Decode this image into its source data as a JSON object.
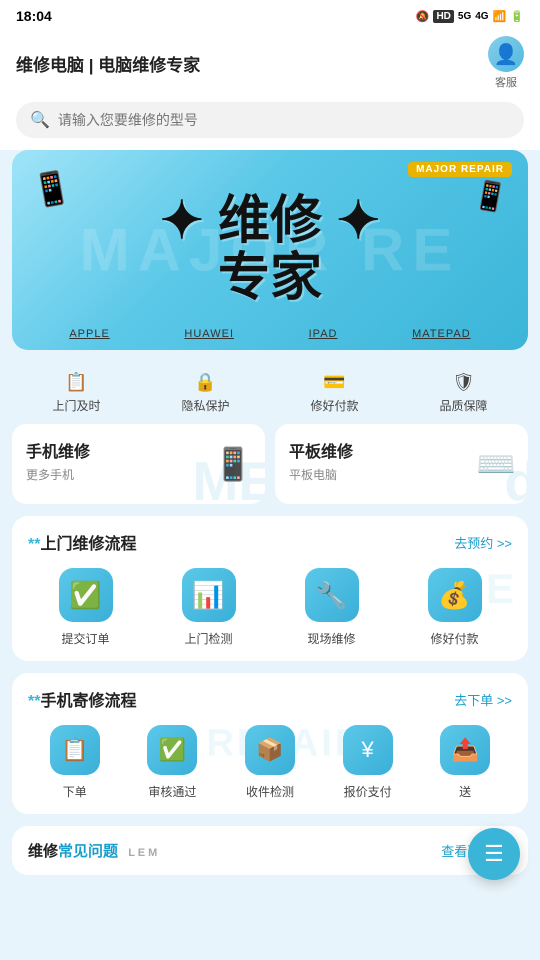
{
  "statusBar": {
    "time": "18:04",
    "icons": [
      "🔕",
      "HD",
      "5G",
      "4G",
      "WiFi",
      "Battery"
    ]
  },
  "header": {
    "title": "维修电脑 | 电脑维修专家",
    "customerService": "客服"
  },
  "search": {
    "placeholder": "请输入您要维修的型号"
  },
  "banner": {
    "badge": "MAJOR REPAIR",
    "mainText": "维修",
    "mainText2": "专家",
    "bgText": "MAJOR RE",
    "brands": [
      "APPLE",
      "HUAWEI",
      "IPAD",
      "MATEPAD"
    ]
  },
  "features": [
    {
      "icon": "📋",
      "label": "上门及时"
    },
    {
      "icon": "🔒",
      "label": "隐私保护"
    },
    {
      "icon": "💳",
      "label": "修好付款"
    },
    {
      "icon": "🛡",
      "label": "品质保障"
    }
  ],
  "serviceCards": [
    {
      "title": "手机维修",
      "subtitle": "更多手机",
      "icon": "📱",
      "bgText": "ME"
    },
    {
      "title": "平板维修",
      "subtitle": "平板电脑",
      "icon": "⌨",
      "bgText": "d"
    }
  ],
  "homepageProcess": {
    "titlePrefix": "**",
    "title": "上门维修流程",
    "linkText": "去预约 >>",
    "steps": [
      {
        "icon": "✅",
        "label": "提交订单"
      },
      {
        "icon": "📈",
        "label": "上门检测"
      },
      {
        "icon": "🔧",
        "label": "现场维修"
      },
      {
        "icon": "💰",
        "label": "修好付款"
      }
    ],
    "bgText": "RE"
  },
  "mailProcess": {
    "titlePrefix": "**",
    "title": "手机寄修流程",
    "linkText": "去下单 >>",
    "steps": [
      {
        "icon": "📋",
        "label": "下单"
      },
      {
        "icon": "✅",
        "label": "审核通过"
      },
      {
        "icon": "📦",
        "label": "收件检测"
      },
      {
        "icon": "¥",
        "label": "报价支付"
      },
      {
        "icon": "📤",
        "label": "送"
      }
    ],
    "bgText": "REPAIR"
  },
  "faq": {
    "titlePrefix": "维修",
    "titleHighlight": "常见问题",
    "linkText": "查看更多 >>",
    "bgText": "LIEM"
  }
}
